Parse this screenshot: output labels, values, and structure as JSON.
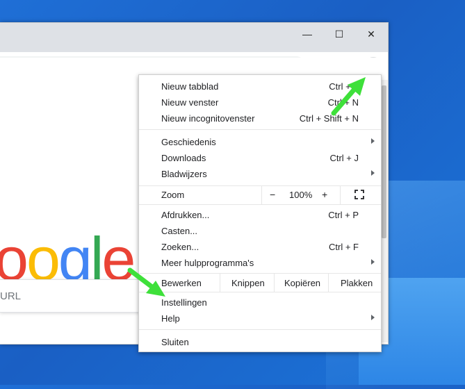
{
  "window": {
    "controls": {
      "minimize": "—",
      "maximize": "☐",
      "close": "✕"
    }
  },
  "toolbar": {
    "bookmark_icon": "star-icon",
    "profile_icon": "account-icon",
    "menu_icon": "three-dots-icon"
  },
  "page": {
    "logo_letters": [
      {
        "char": "o",
        "color": "#ea4335"
      },
      {
        "char": "o",
        "color": "#fbbc05"
      },
      {
        "char": "g",
        "color": "#4285f4"
      },
      {
        "char": "l",
        "color": "#34a853"
      },
      {
        "char": "e",
        "color": "#ea4335"
      }
    ],
    "search_placeholder": "URL"
  },
  "menu": {
    "new_tab": {
      "label": "Nieuw tabblad",
      "shortcut": "Ctrl + T"
    },
    "new_window": {
      "label": "Nieuw venster",
      "shortcut": "Ctrl + N"
    },
    "incognito": {
      "label": "Nieuw incognitovenster",
      "shortcut": "Ctrl + Shift + N"
    },
    "history": {
      "label": "Geschiedenis"
    },
    "downloads": {
      "label": "Downloads",
      "shortcut": "Ctrl + J"
    },
    "bookmarks": {
      "label": "Bladwijzers"
    },
    "zoom": {
      "label": "Zoom",
      "minus": "−",
      "value": "100%",
      "plus": "+"
    },
    "print": {
      "label": "Afdrukken...",
      "shortcut": "Ctrl + P"
    },
    "cast": {
      "label": "Casten..."
    },
    "find": {
      "label": "Zoeken...",
      "shortcut": "Ctrl + F"
    },
    "more_tools": {
      "label": "Meer hulpprogramma's"
    },
    "edit": {
      "label": "Bewerken",
      "cut": "Knippen",
      "copy": "Kopiëren",
      "paste": "Plakken"
    },
    "settings": {
      "label": "Instellingen"
    },
    "help": {
      "label": "Help"
    },
    "exit": {
      "label": "Sluiten"
    }
  },
  "colors": {
    "annotation_arrow": "#3ee03a",
    "desktop": "#1f6fd6"
  }
}
